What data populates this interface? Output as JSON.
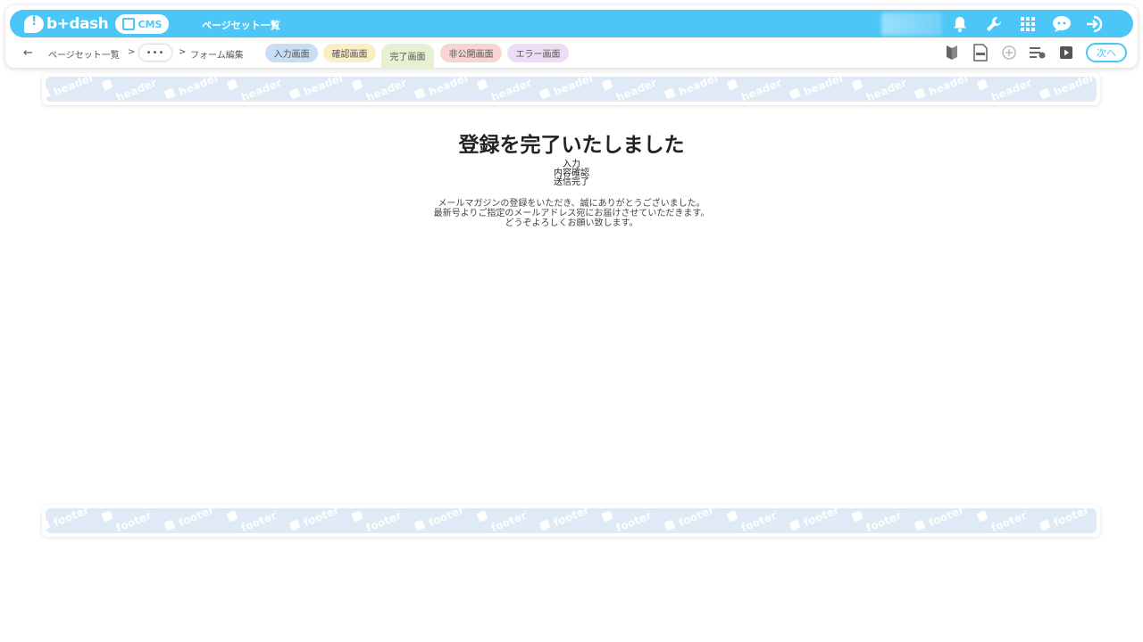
{
  "app": {
    "logo": "b+dash",
    "cms_label": "CMS",
    "title": "ページセット一覧"
  },
  "breadcrumb": {
    "back": "←",
    "item1": "ページセット一覧",
    "sep": ">",
    "more": "•••",
    "item2": "フォーム編集"
  },
  "tabs": [
    {
      "label": "入力画面",
      "color": "#c9def2"
    },
    {
      "label": "確認画面",
      "color": "#fbeec3"
    },
    {
      "label": "完了画面",
      "color": "#e8f0d4"
    },
    {
      "label": "非公開画面",
      "color": "#f9d4d4"
    },
    {
      "label": "エラー画面",
      "color": "#eedcf7"
    }
  ],
  "next_label": "次へ",
  "header_watermark": "header",
  "footer_watermark": "footer",
  "content": {
    "heading": "登録を完了いたしました",
    "steps": [
      "入力",
      "内容確認",
      "送信完了"
    ],
    "message": [
      "メールマガジンの登録をいただき、誠にありがとうございました。",
      "最新号よりご指定のメールアドレス宛にお届けさせていただきます。",
      "どうぞよろしくお願い致します。"
    ]
  },
  "colors": {
    "accent": "#4cc6f6",
    "band": "#dfeaf6"
  }
}
